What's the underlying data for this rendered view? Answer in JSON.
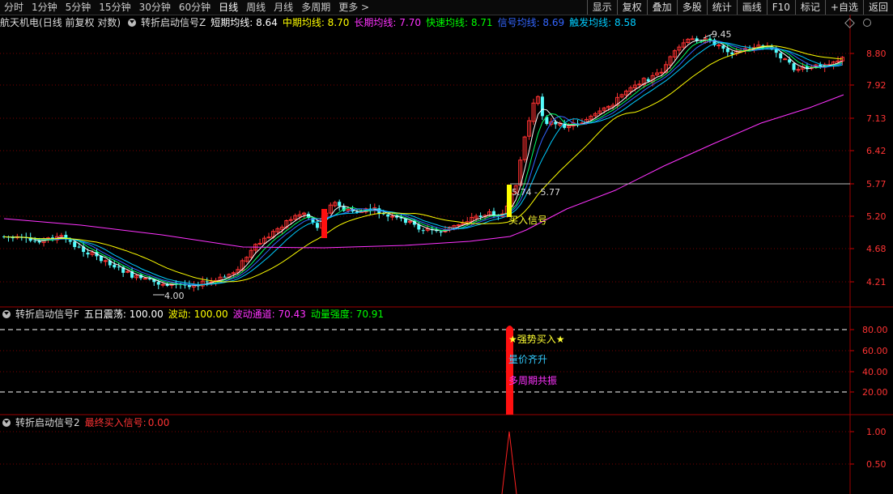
{
  "toolbar": {
    "left": [
      "分时",
      "1分钟",
      "5分钟",
      "15分钟",
      "30分钟",
      "60分钟",
      "日线",
      "周线",
      "月线",
      "多周期",
      "更多 >"
    ],
    "active": "日线",
    "right": [
      "显示",
      "复权",
      "叠加",
      "多股",
      "统计",
      "画线",
      "F10",
      "标记",
      "+自选",
      "返回"
    ]
  },
  "panel1": {
    "stock": "航天机电",
    "mode": "(日线 前复权 对数)",
    "indicator": "转折启动信号Z",
    "lines": [
      {
        "label": "短期均线:",
        "value": "8.64",
        "color": "#ffffff"
      },
      {
        "label": "中期均线:",
        "value": "8.70",
        "color": "#ffff00"
      },
      {
        "label": "长期均线:",
        "value": "7.70",
        "color": "#ff33ff"
      },
      {
        "label": "快速均线:",
        "value": "8.71",
        "color": "#00ff00"
      },
      {
        "label": "信号均线:",
        "value": "8.69",
        "color": "#3366ff"
      },
      {
        "label": "触发均线:",
        "value": "8.58",
        "color": "#00ccff"
      }
    ],
    "y_ticks": [
      "8.80",
      "7.92",
      "7.13",
      "6.42",
      "5.77",
      "5.20",
      "4.68",
      "4.21"
    ],
    "high_label": "9.45",
    "low_label": "4.00",
    "range_label": "5.74 - 5.77",
    "signal_label": "买入信号"
  },
  "panel2": {
    "indicator": "转折启动信号F",
    "fields": [
      {
        "label": "五日震荡:",
        "value": "100.00",
        "color": "#ffffff"
      },
      {
        "label": "波动:",
        "value": "100.00",
        "color": "#ffff00"
      },
      {
        "label": "波动通道:",
        "value": "70.43",
        "color": "#ff33ff"
      },
      {
        "label": "动量强度:",
        "value": "70.91",
        "color": "#00ff00"
      }
    ],
    "y_ticks": [
      "80.00",
      "60.00",
      "40.00",
      "20.00"
    ],
    "notes": [
      {
        "text": "★强势买入★",
        "color": "#ffff33"
      },
      {
        "text": "量价齐升",
        "color": "#33ccff"
      },
      {
        "text": "多周期共振",
        "color": "#ff33ff"
      }
    ]
  },
  "panel3": {
    "indicator": "转折启动信号2",
    "field_label": "最终买入信号:",
    "field_value": "0.00",
    "y_ticks": [
      "1.00",
      "0.50"
    ]
  },
  "colors": {
    "up": "#ff3232",
    "down": "#54fcfc",
    "grid": "#7a0000",
    "signal": "#ff2020",
    "bg": "#000000"
  }
}
